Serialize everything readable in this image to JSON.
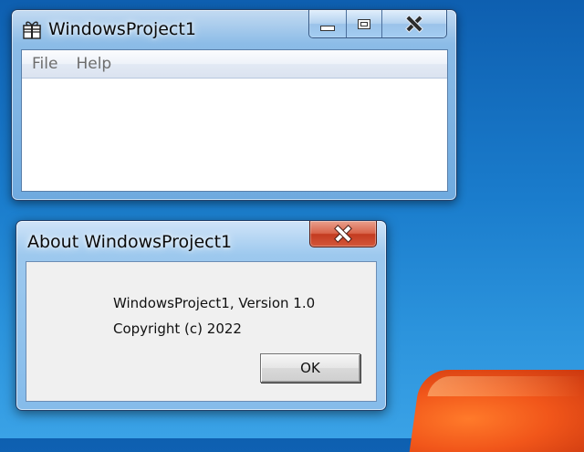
{
  "main_window": {
    "title": "WindowsProject1",
    "icon": "app-gift-icon",
    "caption_buttons": [
      "minimize-icon",
      "maximize-icon",
      "close-icon"
    ],
    "menu": [
      {
        "label": "File"
      },
      {
        "label": "Help"
      }
    ]
  },
  "about_dialog": {
    "title": "About WindowsProject1",
    "close_icon": "close-icon",
    "version_text": "WindowsProject1, Version 1.0",
    "copyright_text": "Copyright (c) 2022",
    "ok_label": "OK"
  },
  "colors": {
    "desktop_blue": "#1a7ccc",
    "close_red": "#c43b20",
    "dialog_face": "#f0f0f0"
  }
}
